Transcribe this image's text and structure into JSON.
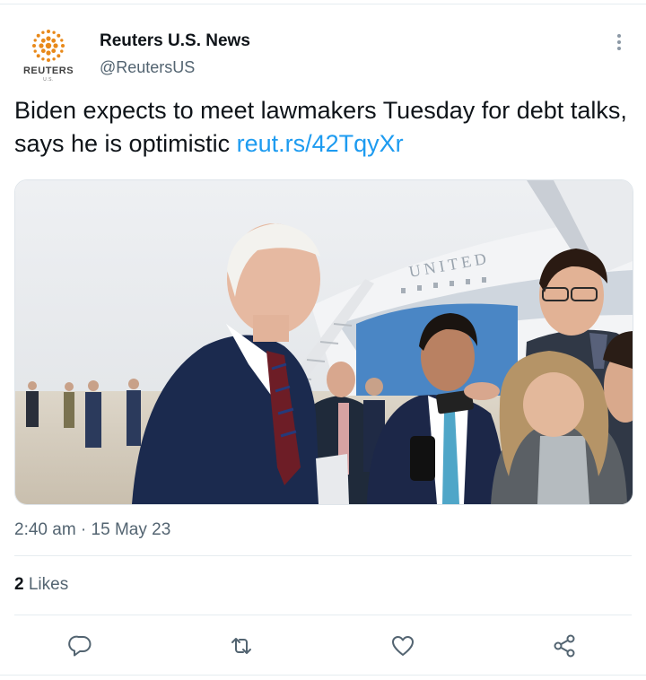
{
  "author": {
    "name": "Reuters U.S. News",
    "handle": "@ReutersUS",
    "logo_text": "REUTERS",
    "logo_subtext": "U.S."
  },
  "tweet": {
    "text": "Biden expects to meet lawmakers Tuesday for debt talks, says he is optimistic ",
    "link_text": "reut.rs/42TqyXr",
    "timestamp": "2:40 am · 15 May 23",
    "likes_count": "2",
    "likes_label": "Likes"
  },
  "photo": {
    "plane_lettering": "UNITED"
  },
  "actions": [
    {
      "icon": "reply-icon"
    },
    {
      "icon": "retweet-icon"
    },
    {
      "icon": "like-icon"
    },
    {
      "icon": "share-icon"
    }
  ],
  "colors": {
    "link": "#1d9bf0",
    "secondary_text": "#536471",
    "primary_text": "#0f1419",
    "logo_gold": "#e8891a"
  }
}
